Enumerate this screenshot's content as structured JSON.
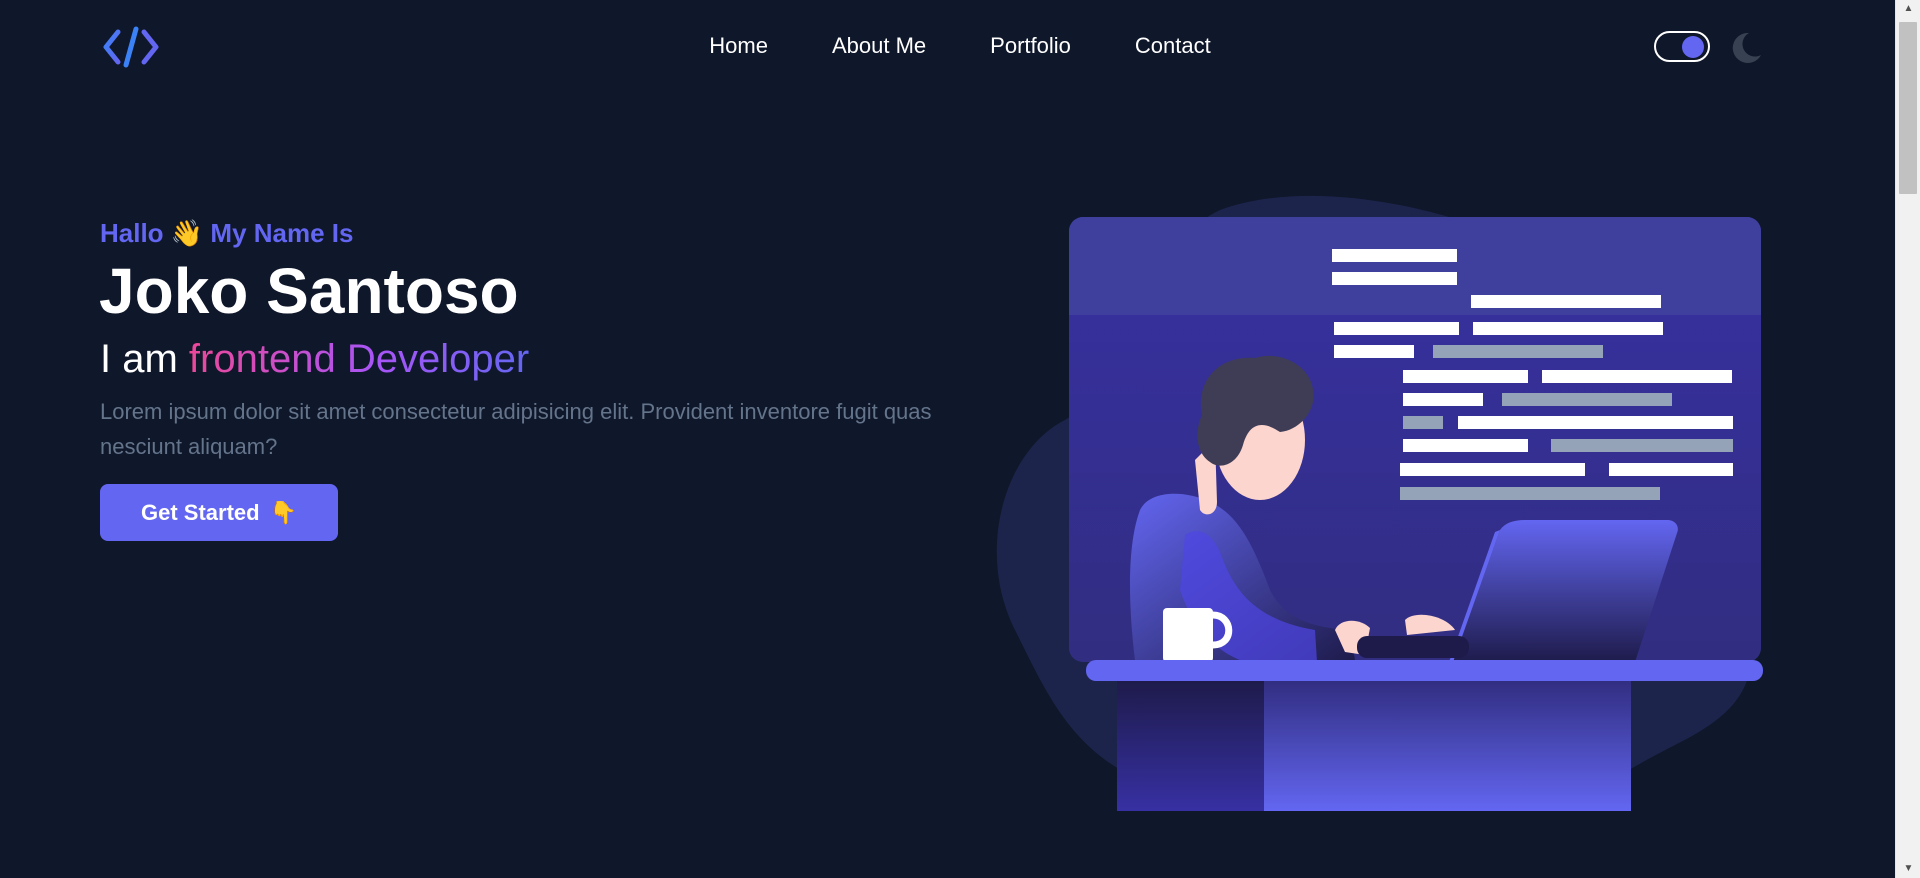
{
  "colors": {
    "background": "#0f172a",
    "accent": "#6366f1",
    "muted_text": "#64748b",
    "gradient_start": "#ec4899",
    "gradient_end": "#6366f1"
  },
  "nav": {
    "logo_icon": "code-brackets-icon",
    "links": [
      "Home",
      "About Me",
      "Portfolio",
      "Contact"
    ],
    "theme_toggle": {
      "state": "on",
      "icon": "moon-icon"
    }
  },
  "hero": {
    "greeting_start": "Hallo",
    "greeting_emoji": "👋",
    "greeting_end": "My Name Is",
    "name": "Joko Santoso",
    "role_prefix": "I am",
    "role": "frontend Developer",
    "description": "Lorem ipsum dolor sit amet consectetur adipisicing elit. Provident inventore fugit quas nesciunt aliquam?",
    "cta_label": "Get Started",
    "cta_emoji": "👇"
  },
  "illustration": {
    "subject": "developer-working-on-laptop-illustration"
  }
}
